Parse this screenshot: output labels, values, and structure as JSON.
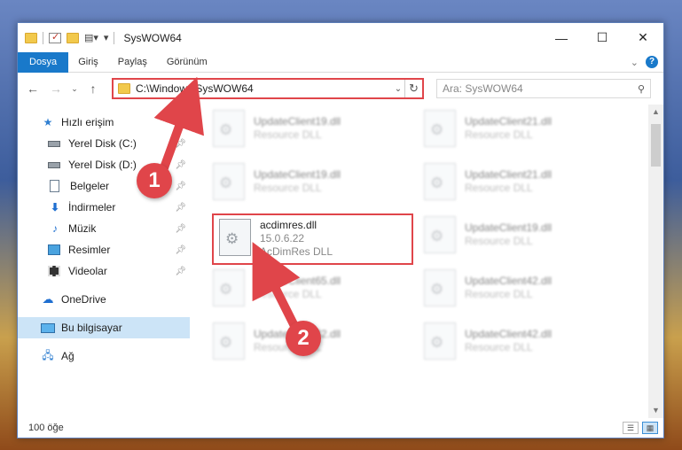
{
  "window": {
    "title": "SysWOW64",
    "controls": {
      "minimize": "—",
      "maximize": "☐",
      "close": "✕"
    }
  },
  "ribbon": {
    "tabs": [
      {
        "label": "Dosya",
        "active": true
      },
      {
        "label": "Giriş",
        "active": false
      },
      {
        "label": "Paylaş",
        "active": false
      },
      {
        "label": "Görünüm",
        "active": false
      }
    ]
  },
  "address": {
    "path": "C:\\Windows\\SysWOW64",
    "search_placeholder": "Ara: SysWOW64"
  },
  "nav": {
    "quick_access": "Hızlı erişim",
    "items": [
      {
        "label": "Yerel Disk (C:)",
        "icon": "drive-icon"
      },
      {
        "label": "Yerel Disk (D:)",
        "icon": "drive-icon"
      },
      {
        "label": "Belgeler",
        "icon": "document-icon"
      },
      {
        "label": "İndirmeler",
        "icon": "download-icon"
      },
      {
        "label": "Müzik",
        "icon": "music-icon"
      },
      {
        "label": "Resimler",
        "icon": "pictures-icon"
      },
      {
        "label": "Videolar",
        "icon": "videos-icon"
      }
    ],
    "onedrive": "OneDrive",
    "this_pc": "Bu bilgisayar",
    "network": "Ağ"
  },
  "files": {
    "background": [
      {
        "name": "UpdateClient19.dll",
        "desc": "Resource DLL"
      },
      {
        "name": "UpdateClient21.dll",
        "desc": "Resource DLL"
      },
      {
        "name": "UpdateClient19.dll",
        "desc": "Resource DLL"
      },
      {
        "name": "UpdateClient21.dll",
        "desc": "Resource DLL"
      },
      {
        "name": "UpdateClient19.dll",
        "desc": "Resource DLL"
      },
      {
        "name": "UpdateClient65.dll",
        "desc": "Resource DLL"
      },
      {
        "name": "UpdateClient42.dll",
        "desc": "Resource DLL"
      },
      {
        "name": "UpdateClient42.dll",
        "desc": "Resource DLL"
      },
      {
        "name": "UpdateClient42.dll",
        "desc": "Resource DLL"
      }
    ],
    "highlighted": {
      "name": "acdimres.dll",
      "version": "15.0.6.22",
      "desc": "AcDimRes DLL"
    }
  },
  "status": {
    "count": "100 öğe"
  },
  "annotations": {
    "step1": "1",
    "step2": "2",
    "color": "#e0454a"
  }
}
